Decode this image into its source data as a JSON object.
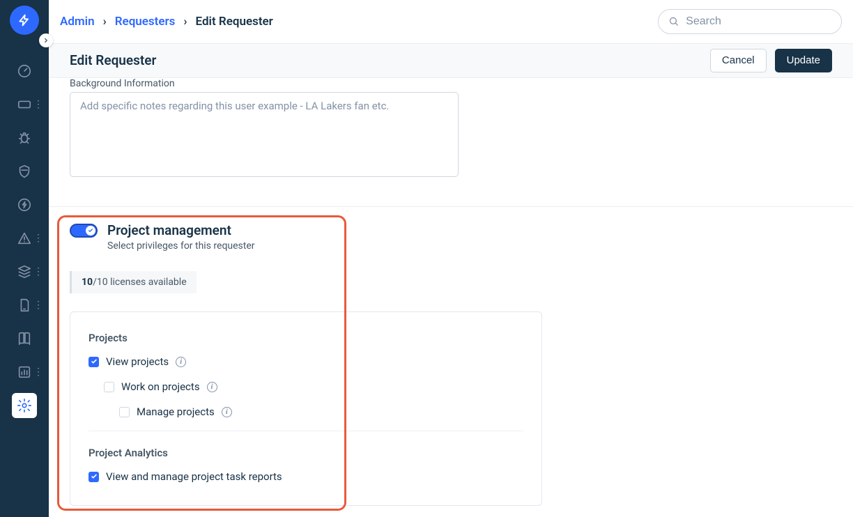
{
  "breadcrumbs": {
    "items": [
      {
        "label": "Admin",
        "link": true
      },
      {
        "label": "Requesters",
        "link": true
      },
      {
        "label": "Edit Requester",
        "link": false
      }
    ]
  },
  "search": {
    "placeholder": "Search"
  },
  "subheader": {
    "title": "Edit Requester",
    "cancel": "Cancel",
    "update": "Update"
  },
  "background_info": {
    "label": "Background Information",
    "placeholder": "Add specific notes regarding this user example - LA Lakers fan etc."
  },
  "project_management": {
    "title": "Project management",
    "subtitle": "Select privileges for this requester",
    "licenses": {
      "available": "10",
      "total": "/10 licenses available"
    },
    "groups": {
      "projects": {
        "title": "Projects",
        "view": "View projects",
        "work": "Work on projects",
        "manage": "Manage projects"
      },
      "analytics": {
        "title": "Project Analytics",
        "view_reports": "View and manage project task reports"
      }
    }
  }
}
